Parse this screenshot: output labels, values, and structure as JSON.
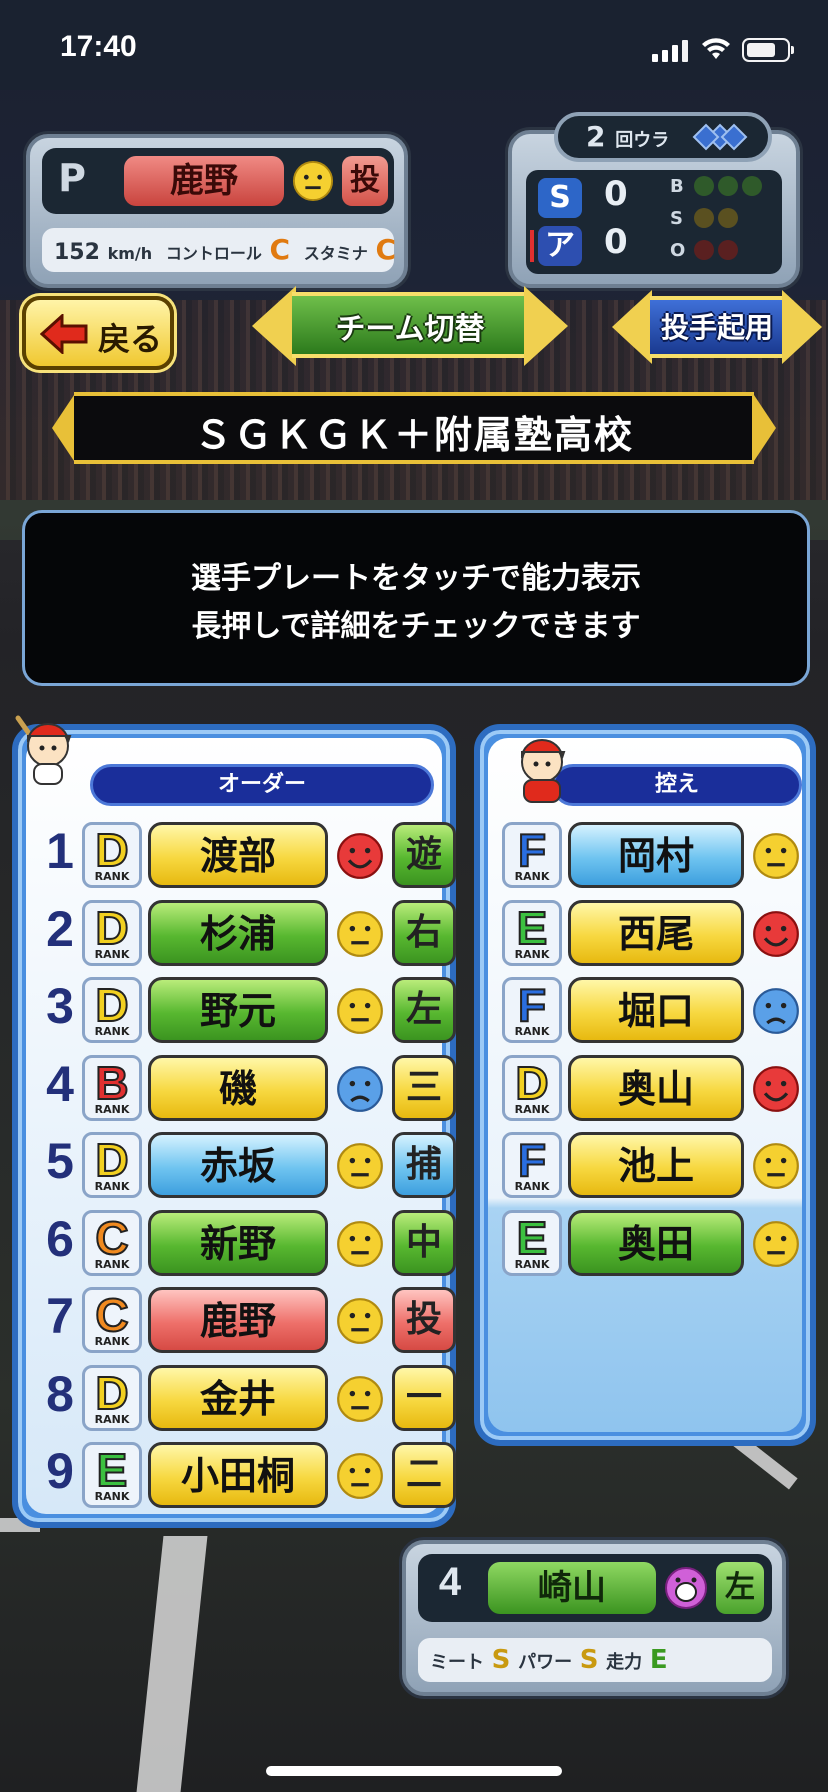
{
  "status_bar": {
    "time": "17:40"
  },
  "pitcher": {
    "position": "P",
    "name": "鹿野",
    "mood": "neutral",
    "role_tag": "投",
    "speed": "152",
    "speed_unit": "km/h",
    "control_label": "コントロール",
    "control_grade": "C",
    "stamina_label": "スタミナ",
    "stamina_grade": "C"
  },
  "scoreboard": {
    "inning": "2",
    "inning_suffix": "回ウラ",
    "team_top": "S",
    "team_top_score": "0",
    "team_bottom": "ア",
    "team_bottom_score": "0",
    "b_label": "B",
    "s_label": "S",
    "o_label": "O",
    "balls": 0,
    "strikes": 0,
    "outs": 0
  },
  "buttons": {
    "back": "戻る",
    "team_switch": "チーム切替",
    "pitcher_change": "投手起用"
  },
  "team_name": "ＳＧＫＧＫ＋附属塾高校",
  "message": {
    "line1": "選手プレートをタッチで能力表示",
    "line2": "長押しで詳細をチェックできます"
  },
  "order": {
    "header": "オーダー",
    "rank_caption": "RANK",
    "players": [
      {
        "num": "1",
        "rank": "D",
        "name": "渡部",
        "color": "yellow",
        "mood": "happy",
        "pos": "遊",
        "pos_color": "green"
      },
      {
        "num": "2",
        "rank": "D",
        "name": "杉浦",
        "color": "green",
        "mood": "neutral",
        "pos": "右",
        "pos_color": "green"
      },
      {
        "num": "3",
        "rank": "D",
        "name": "野元",
        "color": "green",
        "mood": "neutral",
        "pos": "左",
        "pos_color": "green"
      },
      {
        "num": "4",
        "rank": "B",
        "name": "磯",
        "color": "yellow",
        "mood": "sad",
        "pos": "三",
        "pos_color": "yellow"
      },
      {
        "num": "5",
        "rank": "D",
        "name": "赤坂",
        "color": "blue",
        "mood": "neutral",
        "pos": "捕",
        "pos_color": "blue"
      },
      {
        "num": "6",
        "rank": "C",
        "name": "新野",
        "color": "green",
        "mood": "neutral",
        "pos": "中",
        "pos_color": "green"
      },
      {
        "num": "7",
        "rank": "C",
        "name": "鹿野",
        "color": "red",
        "mood": "neutral",
        "pos": "投",
        "pos_color": "red"
      },
      {
        "num": "8",
        "rank": "D",
        "name": "金井",
        "color": "yellow",
        "mood": "neutral",
        "pos": "一",
        "pos_color": "yellow"
      },
      {
        "num": "9",
        "rank": "E",
        "name": "小田桐",
        "color": "yellow",
        "mood": "neutral",
        "pos": "二",
        "pos_color": "yellow"
      }
    ]
  },
  "bench": {
    "header": "控え",
    "players": [
      {
        "rank": "F",
        "name": "岡村",
        "color": "blue",
        "mood": "neutral"
      },
      {
        "rank": "E",
        "name": "西尾",
        "color": "yellow",
        "mood": "happy"
      },
      {
        "rank": "F",
        "name": "堀口",
        "color": "yellow",
        "mood": "sad"
      },
      {
        "rank": "D",
        "name": "奥山",
        "color": "yellow",
        "mood": "happy"
      },
      {
        "rank": "F",
        "name": "池上",
        "color": "yellow",
        "mood": "neutral"
      },
      {
        "rank": "E",
        "name": "奥田",
        "color": "green",
        "mood": "neutral"
      }
    ]
  },
  "batter": {
    "number": "4",
    "name": "崎山",
    "mood": "excited",
    "pos": "左",
    "meet_label": "ミート",
    "meet_grade": "S",
    "power_label": "パワー",
    "power_grade": "S",
    "run_label": "走力",
    "run_grade": "E"
  },
  "rank_colors": {
    "B": "#e03030",
    "C": "#f08a20",
    "D": "#f2d020",
    "E": "#3cc040",
    "F": "#2a6ee0"
  }
}
